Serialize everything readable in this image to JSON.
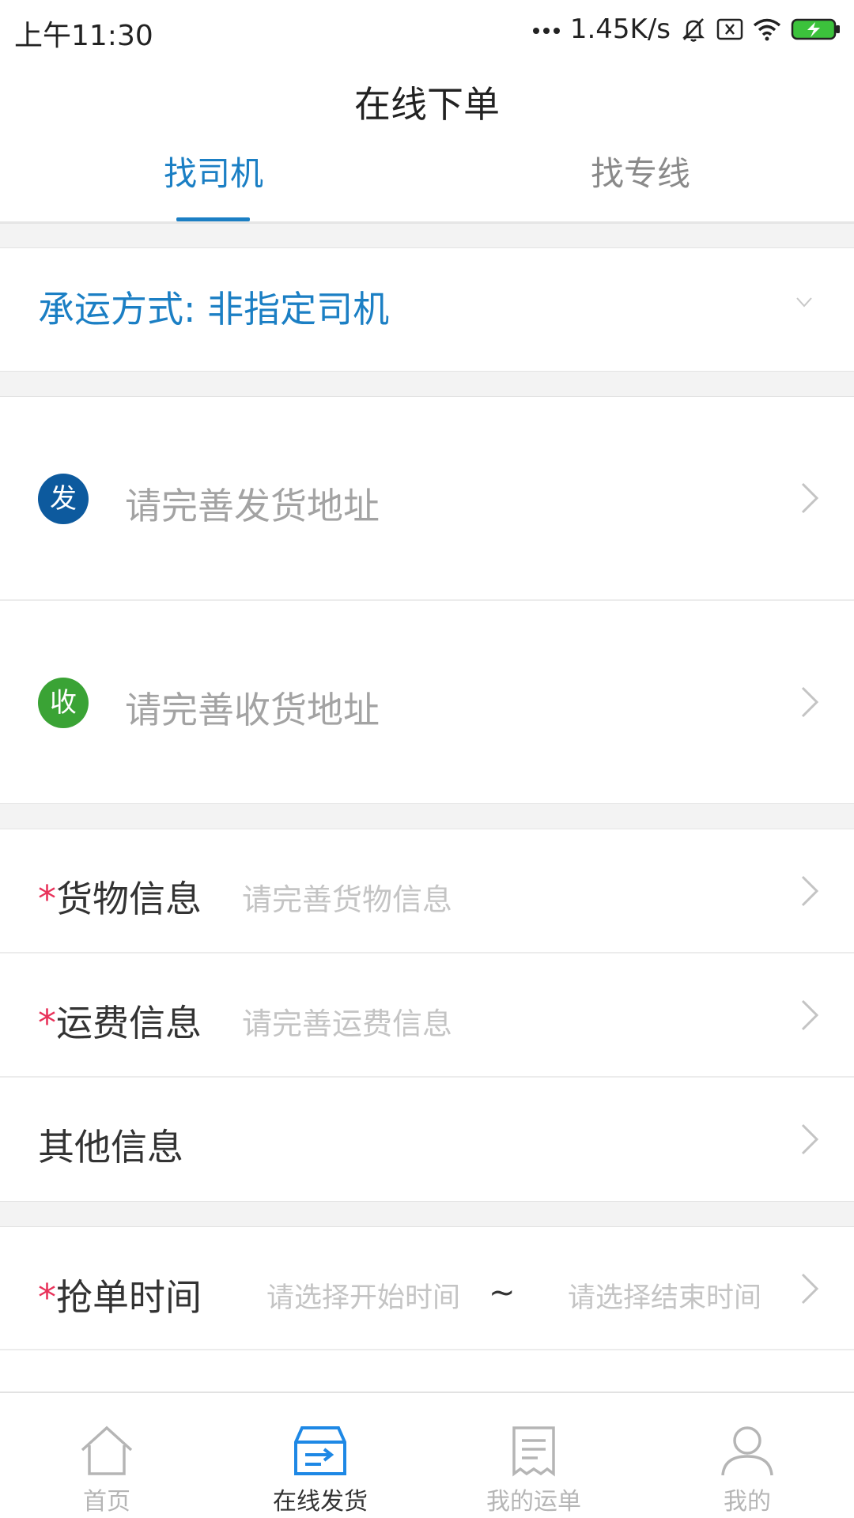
{
  "status_bar": {
    "time": "上午11:30",
    "network_speed": "1.45K/s",
    "icons": [
      "more-dots-icon",
      "silent-bell-icon",
      "sim-x-icon",
      "wifi-icon",
      "battery-charging-icon"
    ]
  },
  "header": {
    "title": "在线下单"
  },
  "tabs": [
    {
      "label": "找司机",
      "active": true
    },
    {
      "label": "找专线",
      "active": false
    }
  ],
  "carrier_mode": {
    "label": "承运方式: 非指定司机",
    "icon": "chevron-down-icon"
  },
  "address": {
    "sender": {
      "badge": "发",
      "placeholder": "请完善发货地址"
    },
    "receiver": {
      "badge": "收",
      "placeholder": "请完善收货地址"
    }
  },
  "info": {
    "required_mark": "*",
    "cargo": {
      "label": "货物信息",
      "placeholder": "请完善货物信息"
    },
    "freight": {
      "label": "运费信息",
      "placeholder": "请完善运费信息"
    },
    "other": {
      "label": "其他信息"
    }
  },
  "grab_time": {
    "label": "抢单时间",
    "start_placeholder": "请选择开始时间",
    "separator": "~",
    "end_placeholder": "请选择结束时间"
  },
  "bottom_nav": [
    {
      "label": "首页",
      "icon": "home-icon",
      "active": false
    },
    {
      "label": "在线发货",
      "icon": "shipping-box-icon",
      "active": true
    },
    {
      "label": "我的运单",
      "icon": "receipt-icon",
      "active": false
    },
    {
      "label": "我的",
      "icon": "user-icon",
      "active": false
    }
  ],
  "colors": {
    "accent": "#1b7fc4",
    "sender_badge": "#0d5a9e",
    "receiver_badge": "#3aa335",
    "required": "#e8325a"
  }
}
